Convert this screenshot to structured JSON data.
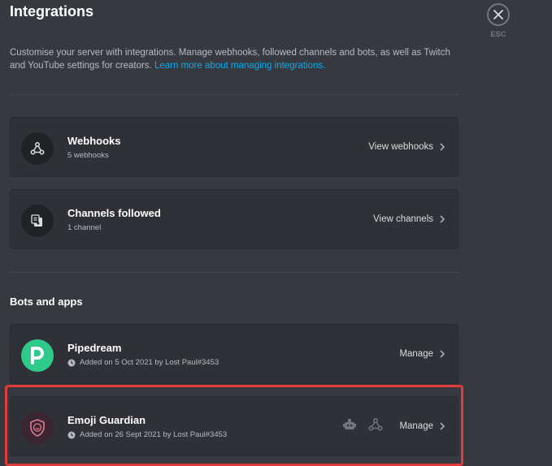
{
  "header": {
    "title": "Integrations",
    "description": "Customise your server with integrations. Manage webhooks, followed channels and bots, as well as Twitch and YouTube settings for creators.",
    "learn_more": "Learn more about managing integrations.",
    "esc_label": "ESC"
  },
  "integrations": [
    {
      "icon": "webhook-icon",
      "name": "Webhooks",
      "detail": "5 webhooks",
      "action": "View webhooks"
    },
    {
      "icon": "channel-follow-icon",
      "name": "Channels followed",
      "detail": "1 channel",
      "action": "View channels"
    }
  ],
  "bots_section": {
    "title": "Bots and apps",
    "items": [
      {
        "icon": "pipedream-logo",
        "name": "Pipedream",
        "added": "Added on 5 Oct 2021 by Lost Paul#3453",
        "action": "Manage"
      },
      {
        "icon": "emoji-guardian-logo",
        "name": "Emoji Guardian",
        "added": "Added on 26 Sept 2021 by Lost Paul#3453",
        "action": "Manage",
        "extra_icons": [
          "robot-icon",
          "webhook-icon"
        ]
      }
    ]
  },
  "colors": {
    "background": "#36393f",
    "card": "#2f3136",
    "link": "#00aff4",
    "highlight": "#e03c3c",
    "pipedream": "#2fca8a"
  }
}
